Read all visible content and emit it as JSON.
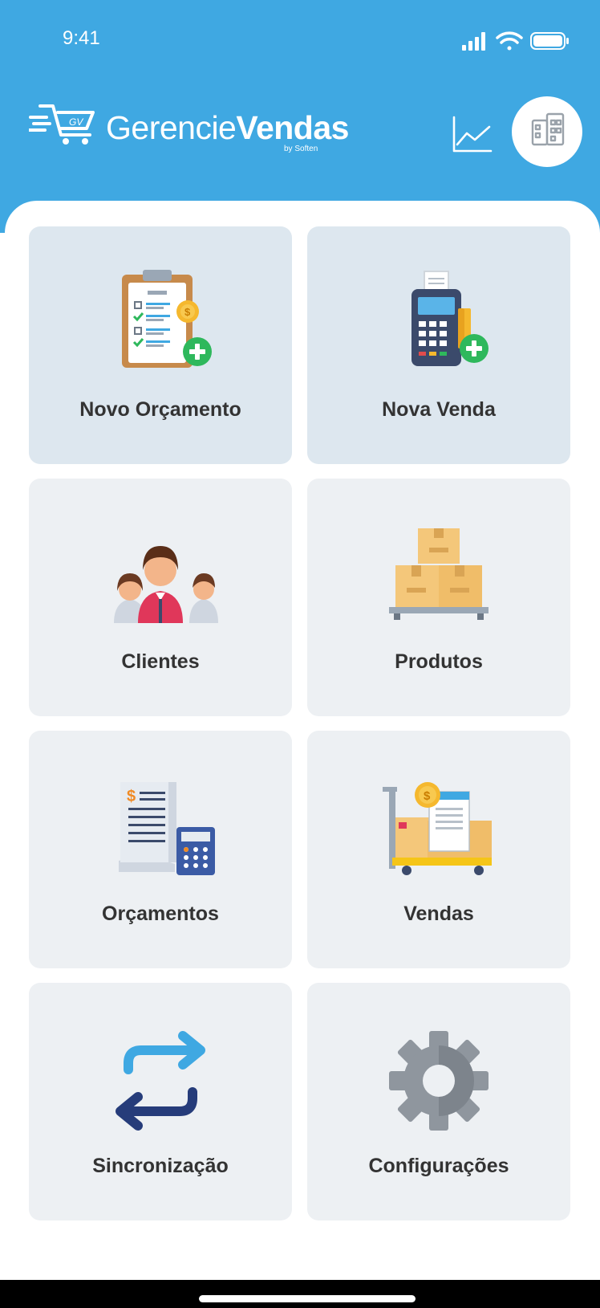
{
  "status_bar": {
    "time": "9:41"
  },
  "header": {
    "brand_regular": "Gerencie",
    "brand_bold": "Vendas",
    "brand_sub": "by Soften",
    "chart_icon": "line-chart-icon",
    "avatar_icon": "building-icon"
  },
  "menu": [
    {
      "label": "Novo Orçamento",
      "icon": "clipboard-add-icon",
      "highlight": true
    },
    {
      "label": "Nova Venda",
      "icon": "card-terminal-add-icon",
      "highlight": true
    },
    {
      "label": "Clientes",
      "icon": "people-icon",
      "highlight": false
    },
    {
      "label": "Produtos",
      "icon": "boxes-icon",
      "highlight": false
    },
    {
      "label": "Orçamentos",
      "icon": "document-calculator-icon",
      "highlight": false
    },
    {
      "label": "Vendas",
      "icon": "cart-invoice-icon",
      "highlight": false
    },
    {
      "label": "Sincronização",
      "icon": "sync-arrows-icon",
      "highlight": false
    },
    {
      "label": "Configurações",
      "icon": "gear-icon",
      "highlight": false
    }
  ],
  "colors": {
    "header_bg": "#3fa8e2",
    "tile_bg": "#edf0f3",
    "tile_highlight_bg": "#dde7ef",
    "label": "#333333"
  }
}
